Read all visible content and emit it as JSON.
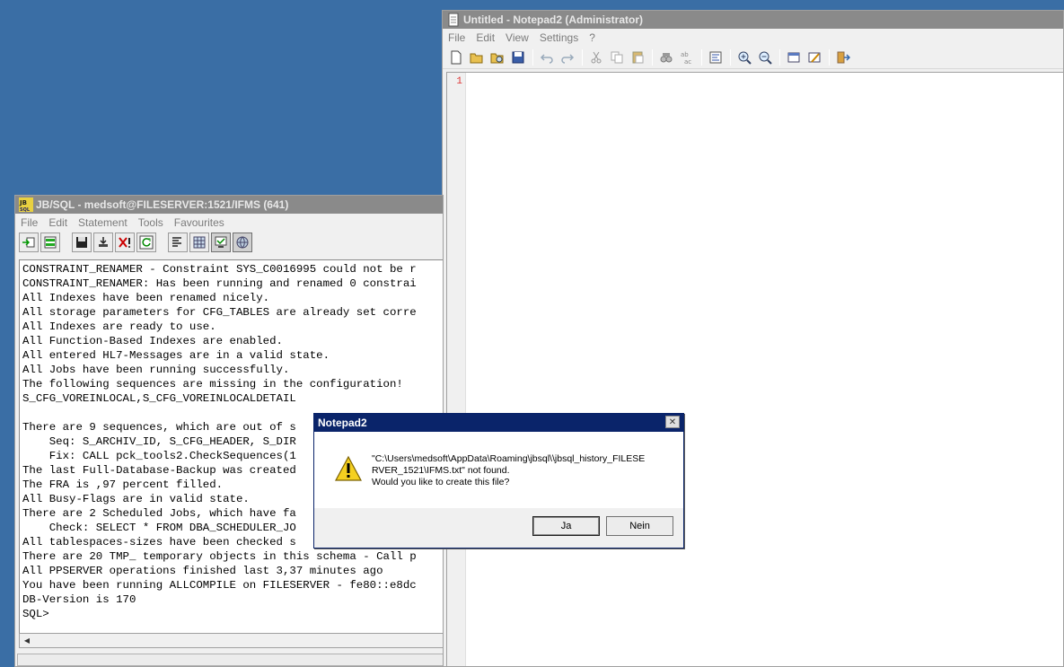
{
  "jbsql": {
    "title": "JB/SQL - medsoft@FILESERVER:1521/IFMS (641)",
    "menu": [
      "File",
      "Edit",
      "Statement",
      "Tools",
      "Favourites"
    ],
    "console_lines": [
      "CONSTRAINT_RENAMER - Constraint SYS_C0016995 could not be r",
      "CONSTRAINT_RENAMER: Has been running and renamed 0 constrai",
      "All Indexes have been renamed nicely.",
      "All storage parameters for CFG_TABLES are already set corre",
      "All Indexes are ready to use.",
      "All Function-Based Indexes are enabled.",
      "All entered HL7-Messages are in a valid state.",
      "All Jobs have been running successfully.",
      "The following sequences are missing in the configuration!",
      "S_CFG_VOREINLOCAL,S_CFG_VOREINLOCALDETAIL",
      "",
      "There are 9 sequences, which are out of s",
      "    Seq: S_ARCHIV_ID, S_CFG_HEADER, S_DIR",
      "    Fix: CALL pck_tools2.CheckSequences(1",
      "The last Full-Database-Backup was created",
      "The FRA is ,97 percent filled.",
      "All Busy-Flags are in valid state.",
      "There are 2 Scheduled Jobs, which have fa",
      "    Check: SELECT * FROM DBA_SCHEDULER_JO",
      "All tablespaces-sizes have been checked s",
      "There are 20 TMP_ temporary objects in this schema - Call p",
      "All PPSERVER operations finished last 3,37 minutes ago",
      "You have been running ALLCOMPILE on FILESERVER - fe80::e8dc",
      "DB-Version is 170",
      "SQL>"
    ]
  },
  "notepad": {
    "title": "Untitled - Notepad2 (Administrator)",
    "menu": [
      "File",
      "Edit",
      "View",
      "Settings",
      "?"
    ],
    "line_number": "1"
  },
  "dialog": {
    "title": "Notepad2",
    "message_line1": "\"C:\\Users\\medsoft\\AppData\\Roaming\\jbsql\\\\jbsql_history_FILESE",
    "message_line2": "RVER_1521\\IFMS.txt\" not found.",
    "message_line3": "Would you like to create this file?",
    "yes_label": "Ja",
    "no_label": "Nein",
    "close_glyph": "✕"
  }
}
